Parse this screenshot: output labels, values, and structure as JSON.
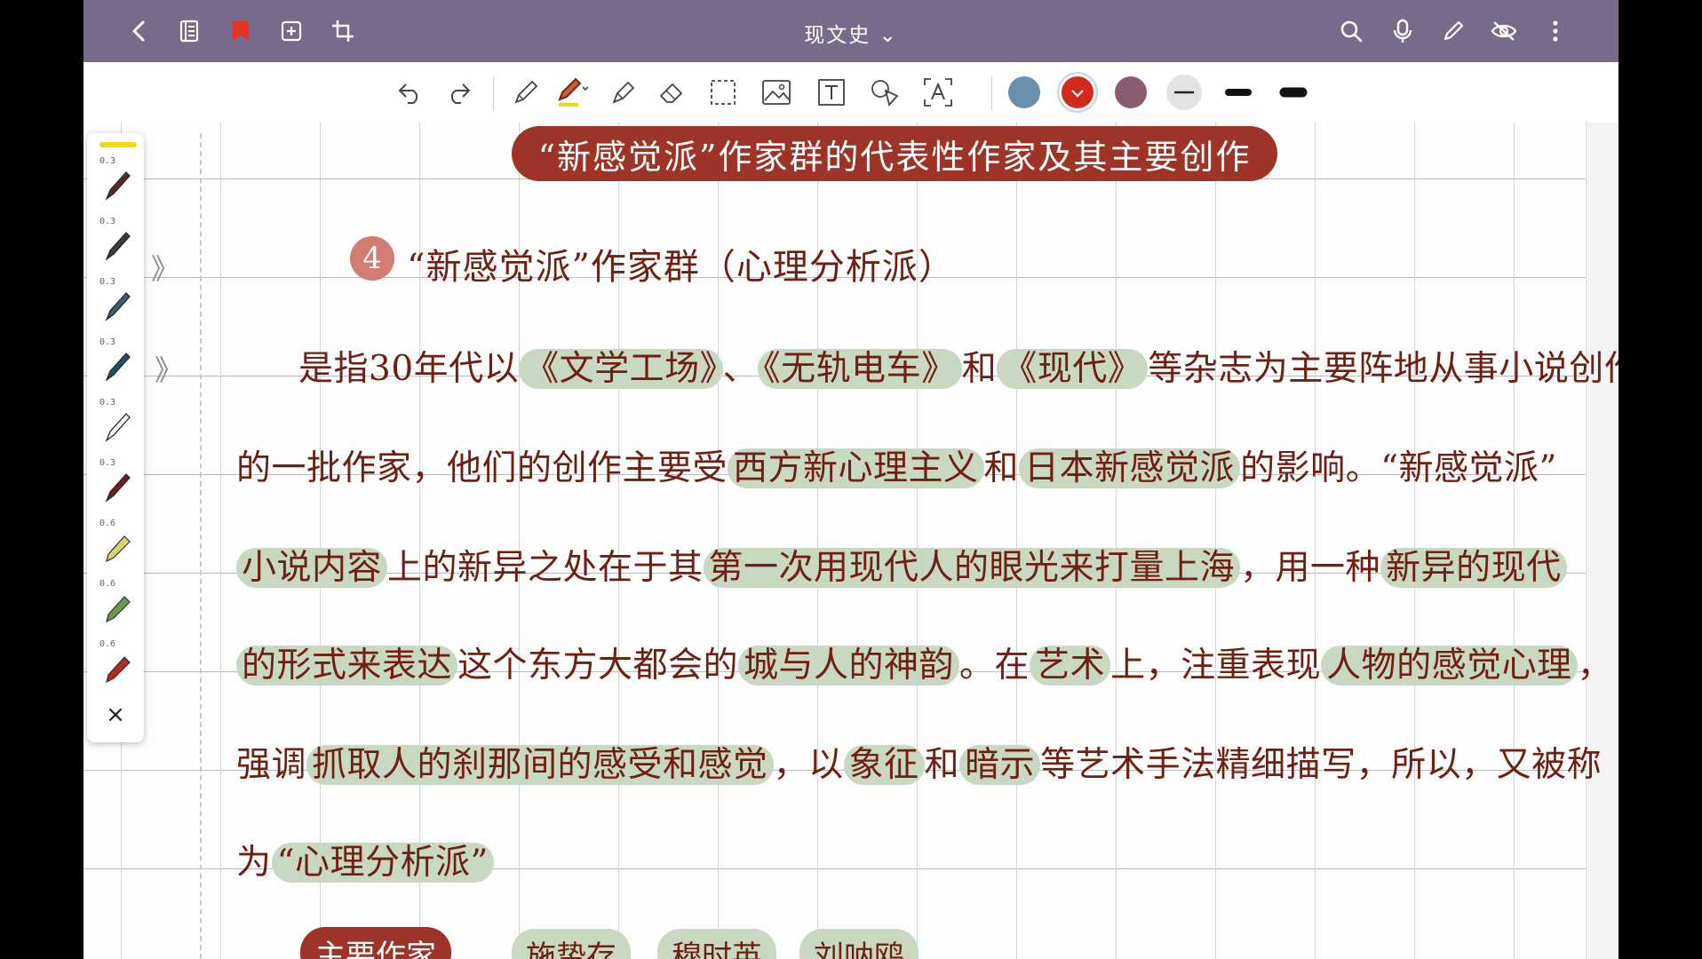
{
  "topbar": {
    "title": "现文史 ⌄",
    "icons": [
      "back-icon",
      "notebook-icon",
      "bookmark-icon",
      "add-page-icon",
      "crop-icon",
      "search-icon",
      "mic-icon",
      "pen-icon",
      "eye-off-icon",
      "more-icon"
    ]
  },
  "toolbar": {
    "tools": [
      "undo-icon",
      "redo-icon",
      "pencil-icon",
      "pen-icon",
      "highlighter-icon",
      "eraser-icon",
      "lasso-icon",
      "image-icon",
      "text-icon",
      "shape-icon",
      "text-recognize-icon"
    ],
    "colors": [
      "#6a8fad",
      "#d12a1c",
      "#8b5b72"
    ],
    "accent": "#776a8a"
  },
  "pens": {
    "sizes": [
      "0.3",
      "0.3",
      "0.3",
      "0.3",
      "0.3",
      "0.3",
      "0.6",
      "0.6",
      "0.6"
    ],
    "close": "×"
  },
  "note": {
    "title": "“新感觉派”作家群的代表性作家及其主要创作",
    "section_number": "4",
    "heading": "“新感觉派”作家群（心理分析派）",
    "l1_a": "是指30年代以",
    "l1_h1": "《文学工场》",
    "l1_b": "、",
    "l1_h2": "《无轨电车》",
    "l1_c": "和",
    "l1_h3": "《现代》",
    "l1_d": "等杂志为主要阵地从事小说创作",
    "l2_a": "的一批作家，他们的创作主要受",
    "l2_h1": "西方新心理主义",
    "l2_b": "和",
    "l2_h2": "日本新感觉派",
    "l2_c": "的影响。“新感觉派”",
    "l3_h1": "小说内容",
    "l3_a": "上的新异之处在于其",
    "l3_h2": "第一次用现代人的眼光来打量上海",
    "l3_b": "，用一种",
    "l3_h3": "新异的现代",
    "l4_h1": "的形式来表达",
    "l4_a": "这个东方大都会的",
    "l4_h2": "城与人的神韵",
    "l4_b": "。在",
    "l4_h3": "艺术",
    "l4_c": "上，注重表现",
    "l4_h4": "人物的感觉心理",
    "l4_d": "，",
    "l5_a": "强调",
    "l5_h1": "抓取人的刹那间的感受和感觉",
    "l5_b": "，以",
    "l5_h2": "象征",
    "l5_c": "和",
    "l5_h3": "暗示",
    "l5_d": "等艺术手法精细描写，所以，又被称",
    "l6_a": "为",
    "l6_h1": "“心理分析派”",
    "main_label": "主要作家",
    "authors": [
      "施蛰存",
      "穆时英",
      "刘呐鸥"
    ]
  }
}
